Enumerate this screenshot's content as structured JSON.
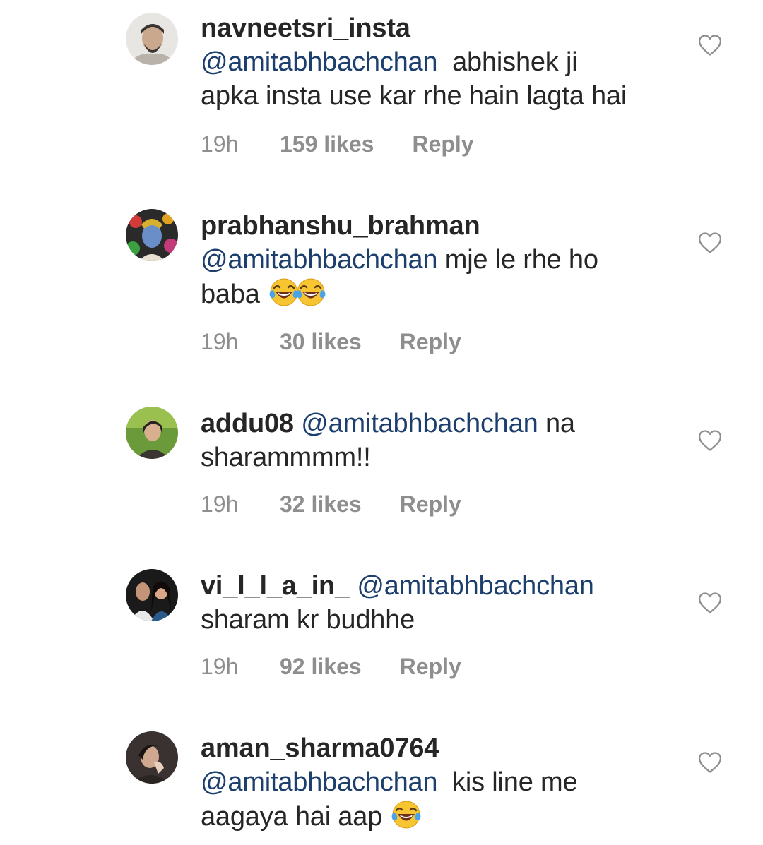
{
  "comments": [
    {
      "username": "navneetsri_insta",
      "mention": "@amitabhbachchan",
      "text_line1": "abhishek ji",
      "text_line2": "apka insta use kar rhe hain lagta hai",
      "time": "19h",
      "likes": "159 likes",
      "reply": "Reply",
      "avatar_icon": "user-avatar-photo",
      "like_icon": "heart-outline-icon"
    },
    {
      "username": "prabhanshu_brahman",
      "mention": "@amitabhbachchan",
      "text_line1": "mje le rhe ho",
      "text_line2": "baba",
      "emoji": "face-with-tears-of-joy x2",
      "time": "19h",
      "likes": "30 likes",
      "reply": "Reply",
      "avatar_icon": "user-avatar-photo",
      "like_icon": "heart-outline-icon"
    },
    {
      "username": "addu08",
      "mention": "@amitabhbachchan",
      "text_line1": "na",
      "text_line2": "sharammmm!!",
      "time": "19h",
      "likes": "32 likes",
      "reply": "Reply",
      "avatar_icon": "user-avatar-photo",
      "like_icon": "heart-outline-icon"
    },
    {
      "username": "vi_l_l_a_in_",
      "mention": "@amitabhbachchan",
      "text_line2": "sharam kr budhhe",
      "time": "19h",
      "likes": "92 likes",
      "reply": "Reply",
      "avatar_icon": "user-avatar-photo",
      "like_icon": "heart-outline-icon"
    },
    {
      "username": "aman_sharma0764",
      "mention": "@amitabhbachchan",
      "text_line1": "kis line me",
      "text_line2": "aagaya hai aap",
      "emoji": "face-with-tears-of-joy",
      "avatar_icon": "user-avatar-photo",
      "like_icon": "heart-outline-icon"
    }
  ],
  "colors": {
    "username": "#262626",
    "mention": "#1d3f6e",
    "meta": "#8e8e8e",
    "heart_outline": "#8e8e8e",
    "background": "#ffffff"
  }
}
